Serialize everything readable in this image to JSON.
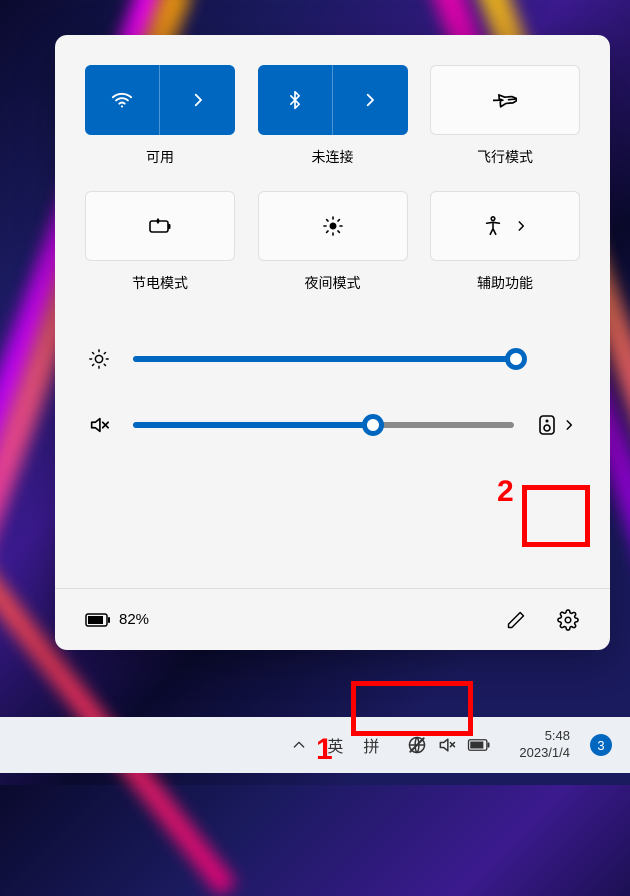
{
  "tiles": {
    "wifi": {
      "label": "可用",
      "active": true
    },
    "bluetooth": {
      "label": "未连接",
      "active": true
    },
    "airplane": {
      "label": "飞行模式",
      "active": false
    },
    "battery_saver": {
      "label": "节电模式",
      "active": false
    },
    "night_light": {
      "label": "夜间模式",
      "active": false
    },
    "accessibility": {
      "label": "辅助功能",
      "active": false
    }
  },
  "sliders": {
    "brightness": {
      "value": 100
    },
    "volume": {
      "value": 63,
      "muted": true
    }
  },
  "footer": {
    "battery_percent": "82%"
  },
  "taskbar": {
    "ime_lang": "英",
    "ime_mode": "拼",
    "time": "5:48",
    "date": "2023/1/4",
    "notification_count": "3"
  },
  "annotations": {
    "label1": "1",
    "label2": "2"
  }
}
